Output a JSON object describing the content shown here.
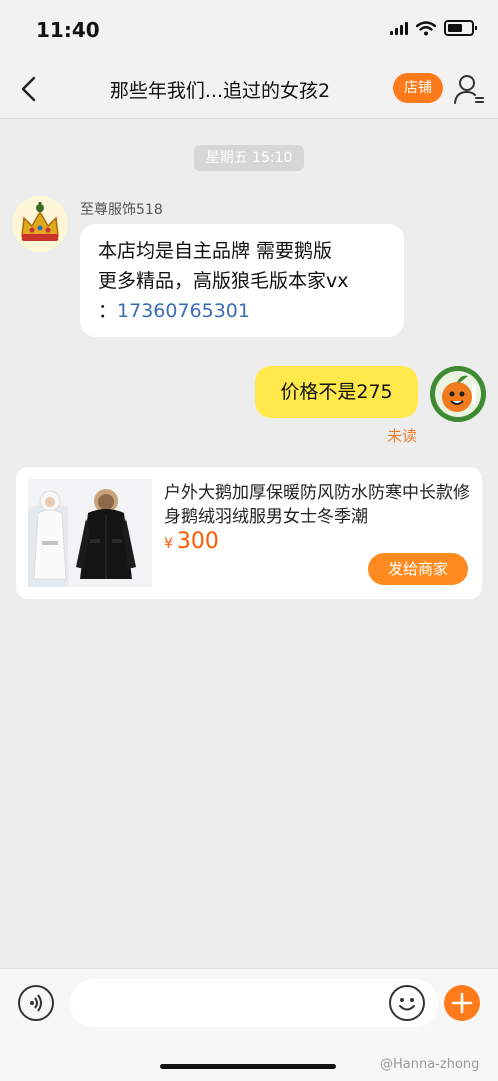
{
  "status_bar": {
    "time": "11:40"
  },
  "nav": {
    "title": "那些年我们...追过的女孩2",
    "shop_button": "店铺",
    "icons": {
      "back": "back-chevron-icon",
      "user": "user-profile-icon"
    }
  },
  "chat": {
    "timestamp": "星期五 15:10",
    "incoming": {
      "sender": "至尊服饰518",
      "line1": "本店均是自主品牌 需要鹅版",
      "line2": "更多精品，高版狼毛版本家vx",
      "line3_prefix": "：",
      "phone": "17360765301"
    },
    "outgoing": {
      "text": "价格不是275",
      "status": "未读"
    }
  },
  "product_card": {
    "title": "户外大鹅加厚保暖防风防水防寒中长款修身鹅绒羽绒服男女士冬季潮",
    "currency": "¥",
    "price": "300",
    "send_button": "发给商家"
  },
  "input_bar": {
    "placeholder": "",
    "icons": {
      "voice": "voice-icon",
      "emoji": "emoji-icon",
      "plus": "plus-icon"
    }
  },
  "watermark": "@Hanna-zhong",
  "colors": {
    "accent": "#ff7a1a",
    "bubble_out": "#ffe94a",
    "link": "#3a6db5",
    "background": "#ededed"
  }
}
